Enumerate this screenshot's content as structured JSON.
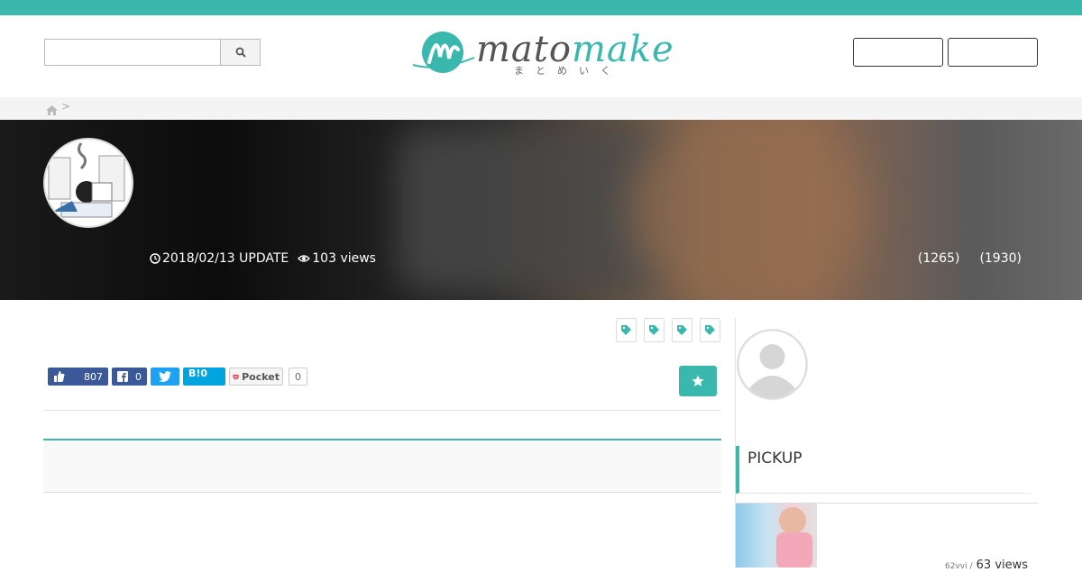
{
  "header": {
    "search": {
      "placeholder": "",
      "value": ""
    },
    "logo": {
      "text_main": "mato",
      "text_accent": "make",
      "subtitle": "まとめいく"
    },
    "buttons": [
      {
        "label": ""
      },
      {
        "label": ""
      }
    ]
  },
  "breadcrumb": {
    "separator": ">"
  },
  "article": {
    "date": "2018/02/13 UPDATE",
    "views": "103 views",
    "count_1": "(1265)",
    "count_2": "(1930)",
    "tags_count": 4
  },
  "share": {
    "facebook_like": "807",
    "facebook_share": "0",
    "hatena": "B!0",
    "pocket_label": "Pocket",
    "pocket_count": "0"
  },
  "sidebar": {
    "pickup_title": "PICKUP",
    "item_1": {
      "views_small": "62vvi /",
      "views": "63 views"
    }
  },
  "colors": {
    "accent": "#3ab8ad",
    "facebook": "#3b5998",
    "twitter": "#1da1f2",
    "hatena": "#00a4de"
  }
}
